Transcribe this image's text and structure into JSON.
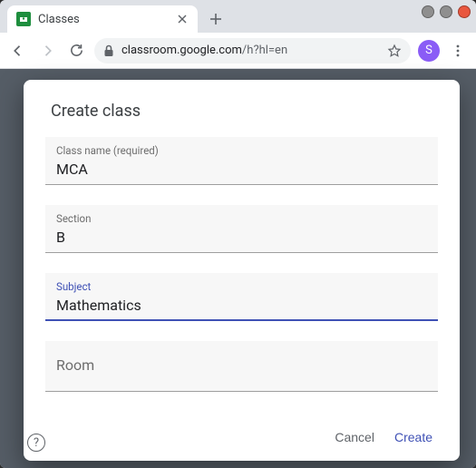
{
  "window": {
    "tab_title": "Classes",
    "tab_favicon_letter": "⊡"
  },
  "toolbar": {
    "url_prefix": "classroom.google.com",
    "url_suffix": "/h?hl=en",
    "avatar_letter": "S"
  },
  "dialog": {
    "title": "Create class",
    "fields": {
      "classname": {
        "label": "Class name (required)",
        "value": "MCA"
      },
      "section": {
        "label": "Section",
        "value": "B"
      },
      "subject": {
        "label": "Subject",
        "value": "Mathematics"
      },
      "room": {
        "label": "Room",
        "value": ""
      }
    },
    "buttons": {
      "cancel": "Cancel",
      "create": "Create"
    }
  }
}
